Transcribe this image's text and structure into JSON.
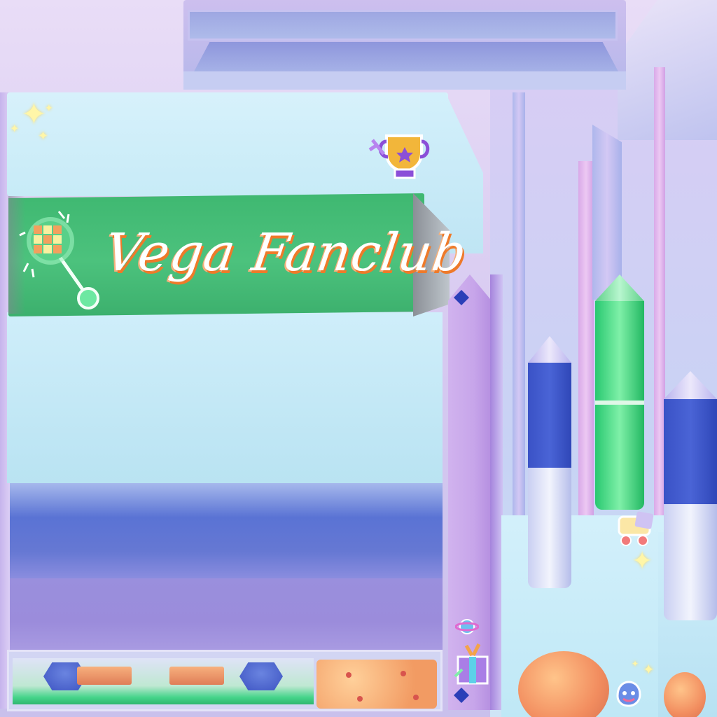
{
  "banner": {
    "title": "Vega Fanclub"
  },
  "palette": {
    "banner_green": "#3fb871",
    "panel_blue": "#5a73d4",
    "panel_purple": "#9b8cdb",
    "light_cyan": "#cfeefa",
    "lavender": "#d1b3ee",
    "tube_blue": "#3a52c6",
    "tube_green": "#28c870",
    "peach": "#f29b63",
    "title_shadow": "#ee7a2a"
  },
  "icons": {
    "wand": "disco-ball-wand-icon",
    "trophy": "trophy-sticker-icon",
    "roller_skate": "roller-skate-sticker-icon",
    "planet": "planet-sticker-icon",
    "gift": "gift-sticker-icon",
    "glove": "glove-sticker-icon",
    "sparkle": "sparkle-icon"
  }
}
